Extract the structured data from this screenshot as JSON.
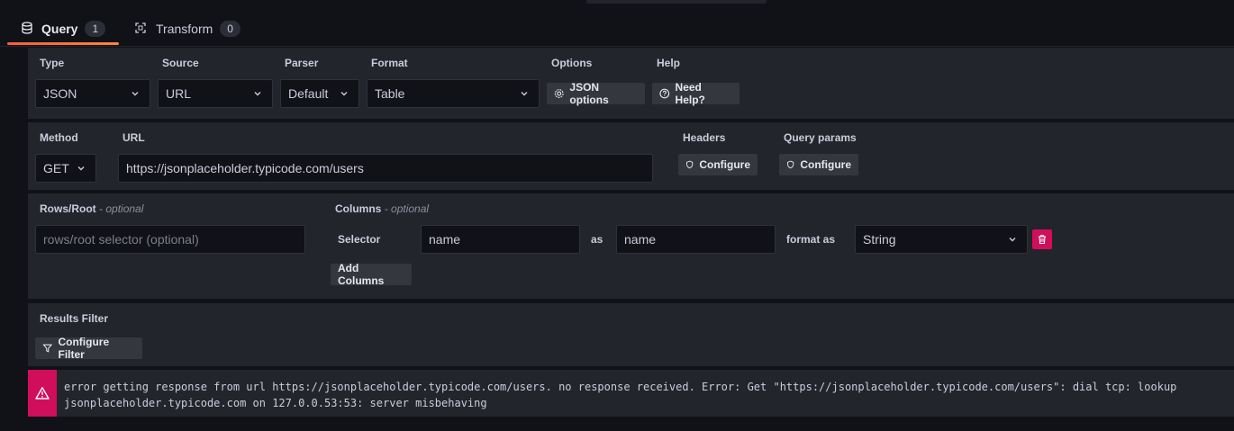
{
  "tabs": [
    {
      "label": "Query",
      "count": "1"
    },
    {
      "label": "Transform",
      "count": "0"
    }
  ],
  "row1": {
    "type_label": "Type",
    "type_value": "JSON",
    "source_label": "Source",
    "source_value": "URL",
    "parser_label": "Parser",
    "parser_value": "Default",
    "format_label": "Format",
    "format_value": "Table",
    "options_label": "Options",
    "json_options_button": "JSON options",
    "help_label": "Help",
    "need_help_button": "Need Help?"
  },
  "row2": {
    "method_label": "Method",
    "method_value": "GET",
    "url_label": "URL",
    "url_value": "https://jsonplaceholder.typicode.com/users",
    "headers_label": "Headers",
    "headers_button": "Configure",
    "query_params_label": "Query params",
    "query_params_button": "Configure"
  },
  "row3": {
    "rows_root_label": "Rows/Root",
    "rows_root_optional": "- optional",
    "rows_root_placeholder": "rows/root selector (optional)",
    "columns_label": "Columns",
    "columns_optional": "- optional",
    "selector_label": "Selector",
    "selector_value": "name",
    "as_label": "as",
    "alias_value": "name",
    "format_as_label": "format as",
    "format_as_value": "String",
    "add_columns_button": "Add Columns"
  },
  "row4": {
    "results_filter_label": "Results Filter",
    "configure_filter_button": "Configure Filter"
  },
  "error": {
    "message": "error getting response from url https://jsonplaceholder.typicode.com/users. no response received. Error: Get \"https://jsonplaceholder.typicode.com/users\": dial tcp: lookup jsonplaceholder.typicode.com on 127.0.0.53:53: server misbehaving"
  },
  "colors": {
    "background": "#111217",
    "panel": "#22252b",
    "accent_tab": "#ff8833",
    "danger": "#d10e5c"
  }
}
